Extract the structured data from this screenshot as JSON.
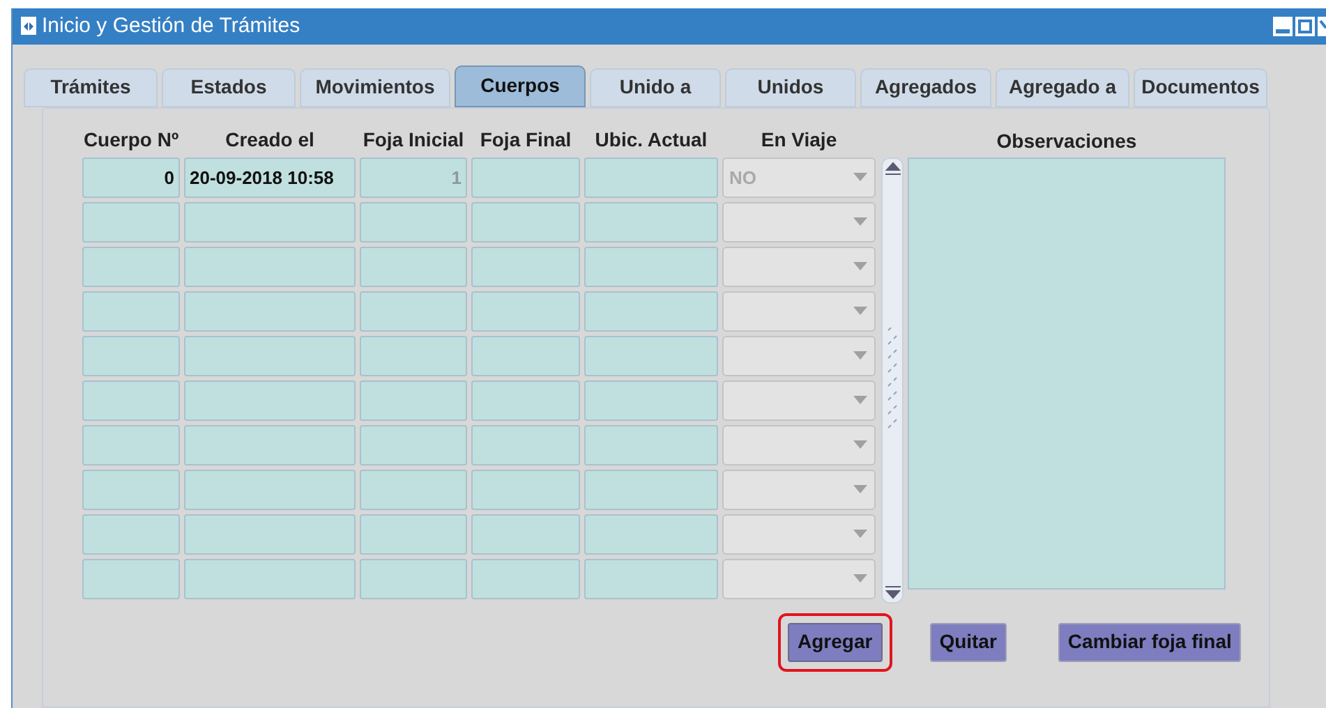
{
  "window": {
    "title": "Inicio y Gestión de Trámites"
  },
  "tabs": [
    {
      "label": "Trámites",
      "selected": false
    },
    {
      "label": "Estados",
      "selected": false
    },
    {
      "label": "Movimientos",
      "selected": false
    },
    {
      "label": "Cuerpos",
      "selected": true
    },
    {
      "label": "Unido a",
      "selected": false
    },
    {
      "label": "Unidos",
      "selected": false
    },
    {
      "label": "Agregados",
      "selected": false
    },
    {
      "label": "Agregado a",
      "selected": false
    },
    {
      "label": "Documentos",
      "selected": false
    }
  ],
  "table": {
    "columns": [
      "Cuerpo Nº",
      "Creado el",
      "Foja Inicial",
      "Foja Final",
      "Ubic. Actual",
      "En Viaje"
    ],
    "rows": [
      {
        "cuerpo_n": "0",
        "creado_el": "20-09-2018 10:58",
        "foja_inicial": "1",
        "en_viaje": "NO"
      },
      {},
      {},
      {},
      {},
      {},
      {},
      {},
      {},
      {}
    ]
  },
  "observaciones": {
    "label": "Observaciones"
  },
  "buttons": [
    {
      "label": "Agregar",
      "focused": true
    },
    {
      "label": "Quitar",
      "focused": false
    },
    {
      "label": "Cambiar foja final",
      "focused": false
    }
  ]
}
